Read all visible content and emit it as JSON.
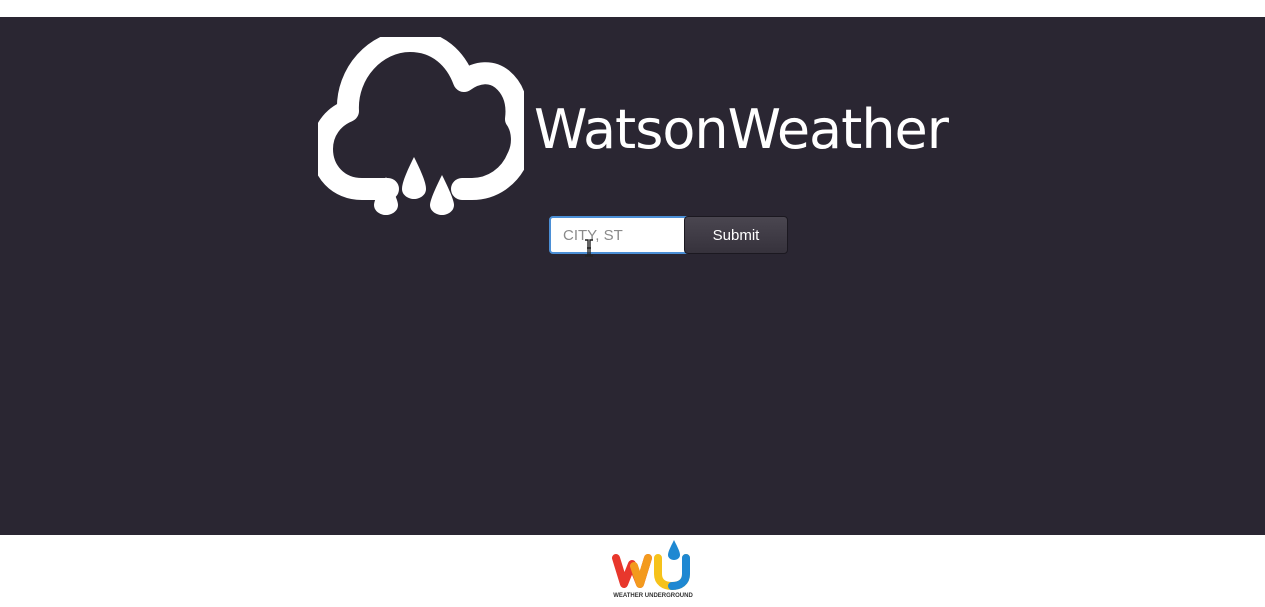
{
  "header": {
    "brand": "WatsonWeather",
    "icon": "cloud-rain-icon"
  },
  "search": {
    "placeholder": "CITY, ST",
    "value": "",
    "submit_label": "Submit"
  },
  "footer": {
    "logo": "weather-underground-logo",
    "logo_text": "WEATHER UNDERGROUND"
  },
  "colors": {
    "background": "#2a2632",
    "text": "#ffffff",
    "input_focus_border": "#4b8fd6"
  }
}
